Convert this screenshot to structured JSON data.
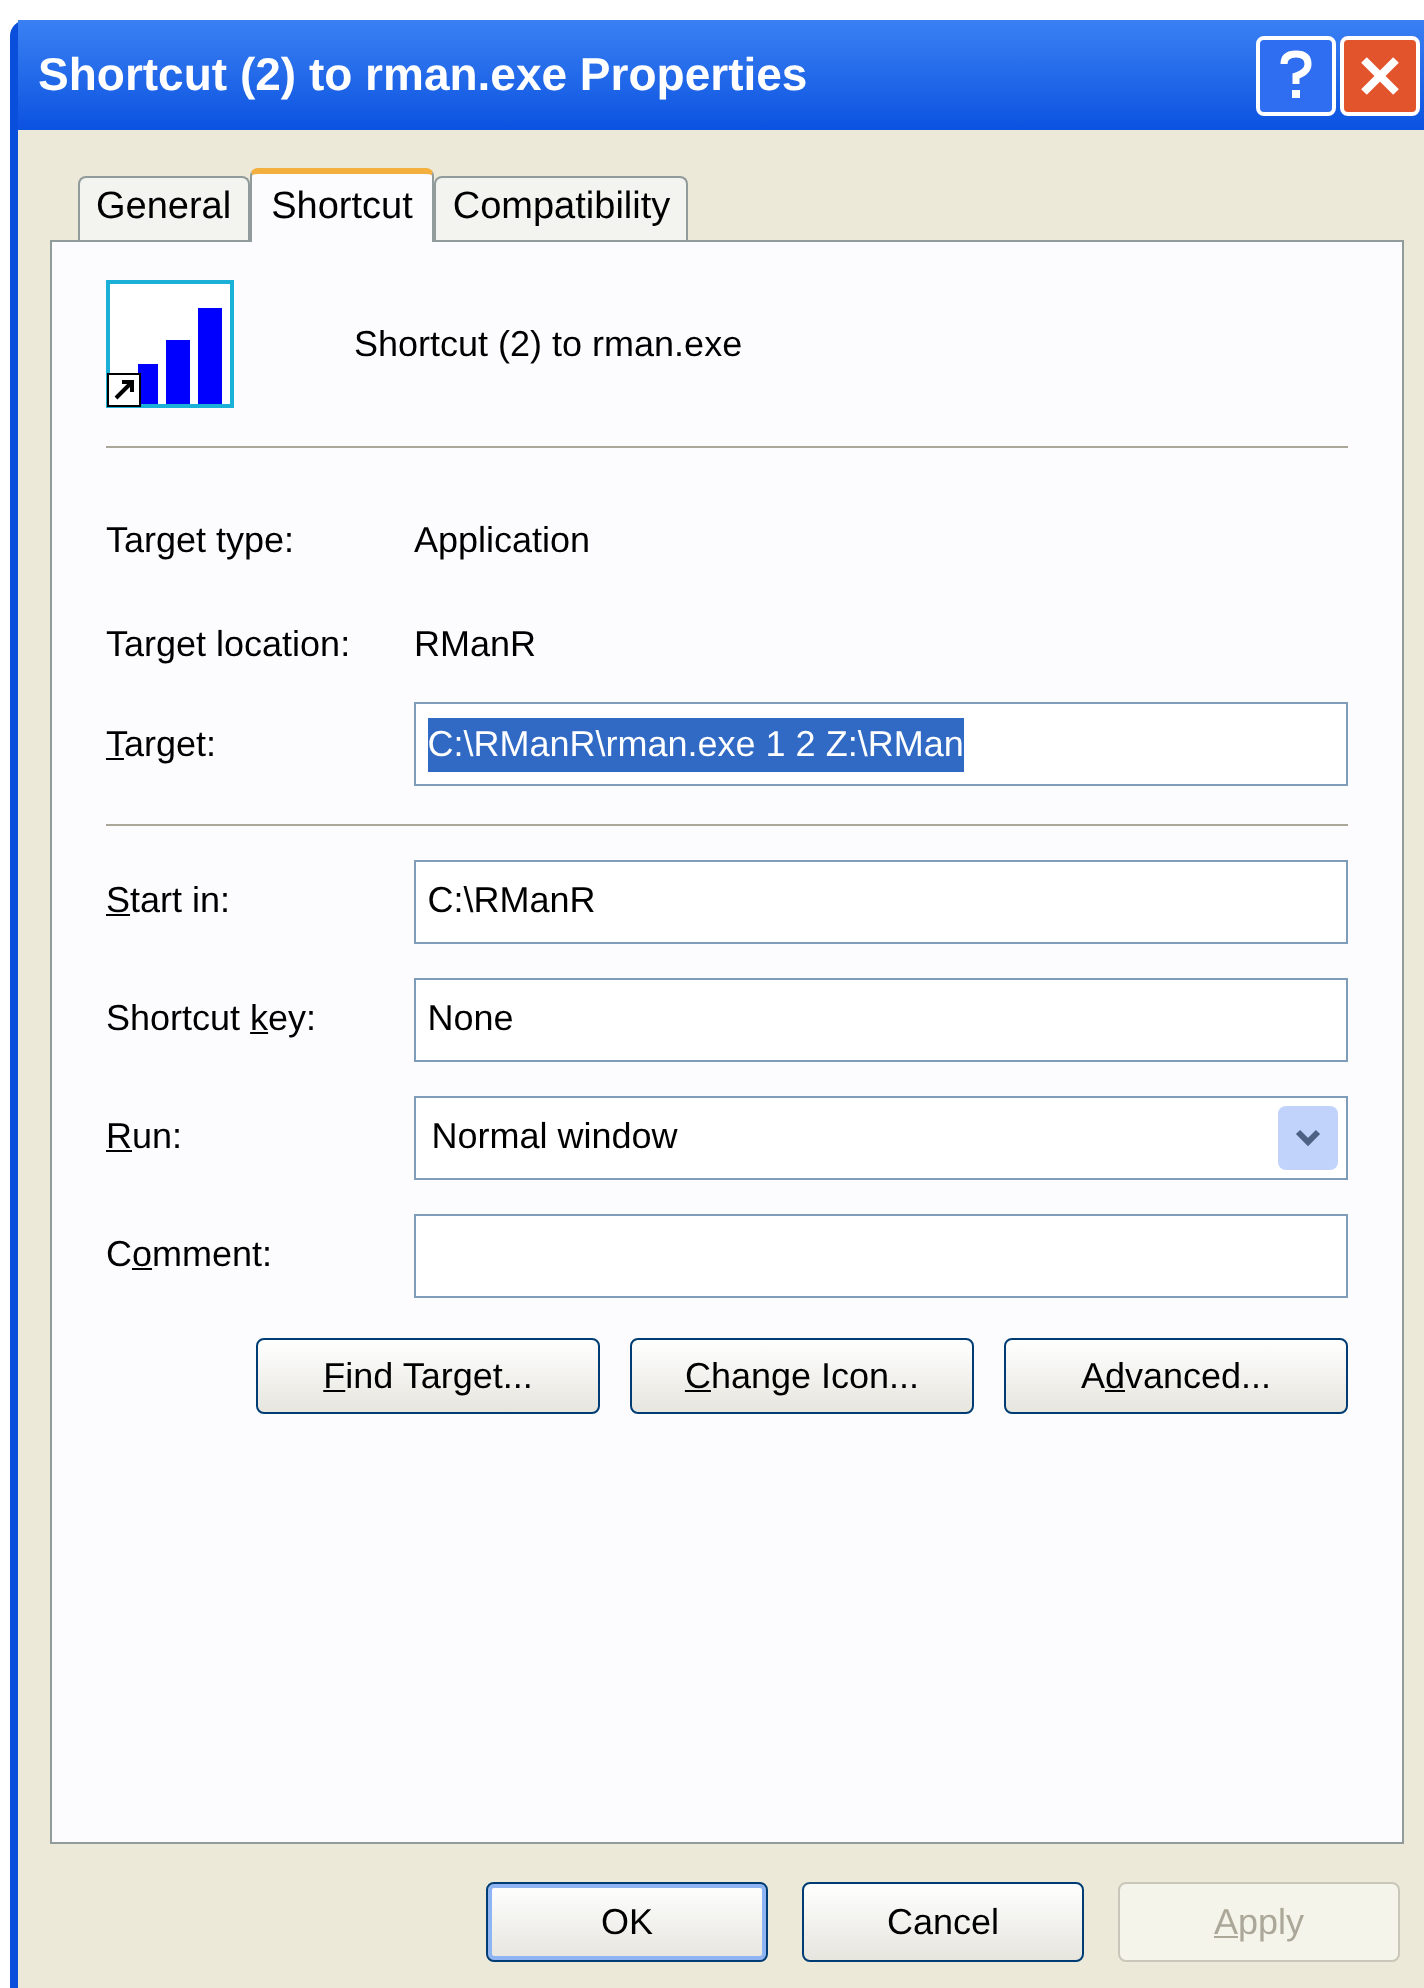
{
  "window": {
    "title": "Shortcut (2) to rman.exe Properties"
  },
  "tabs": [
    {
      "label": "General",
      "selected": false
    },
    {
      "label": "Shortcut",
      "selected": true
    },
    {
      "label": "Compatibility",
      "selected": false
    }
  ],
  "header": {
    "name": "Shortcut (2) to rman.exe"
  },
  "info": [
    {
      "label": "Target type:",
      "value": "Application"
    },
    {
      "label": "Target location:",
      "value": "RManR"
    }
  ],
  "target": {
    "label": {
      "key": "T",
      "post": "arget:"
    },
    "value": "C:\\RManR\\rman.exe 1 2 Z:\\RMan",
    "selected": true
  },
  "fields": [
    {
      "kind": "text",
      "label": {
        "key": "S",
        "post": "tart in:"
      },
      "value": "C:\\RManR"
    },
    {
      "kind": "text",
      "label": {
        "pre": "Shortcut ",
        "key": "k",
        "post": "ey:"
      },
      "value": "None"
    },
    {
      "kind": "select",
      "label": {
        "key": "R",
        "post": "un:"
      },
      "value": "Normal window"
    },
    {
      "kind": "text",
      "label": {
        "pre": "C",
        "key": "o",
        "post": "mment:"
      }
    }
  ],
  "actions": [
    {
      "label": {
        "key": "F",
        "post": "ind Target..."
      }
    },
    {
      "label": {
        "key": "C",
        "post": "hange Icon..."
      }
    },
    {
      "label": {
        "pre": "A",
        "key": "d",
        "post": "vanced..."
      }
    }
  ],
  "buttons": [
    {
      "label": {
        "pre": "OK"
      },
      "disabled": false,
      "default": true
    },
    {
      "label": {
        "pre": "Cancel"
      },
      "disabled": false,
      "default": false
    },
    {
      "label": {
        "key": "A",
        "post": "pply"
      },
      "disabled": true,
      "default": false
    }
  ]
}
